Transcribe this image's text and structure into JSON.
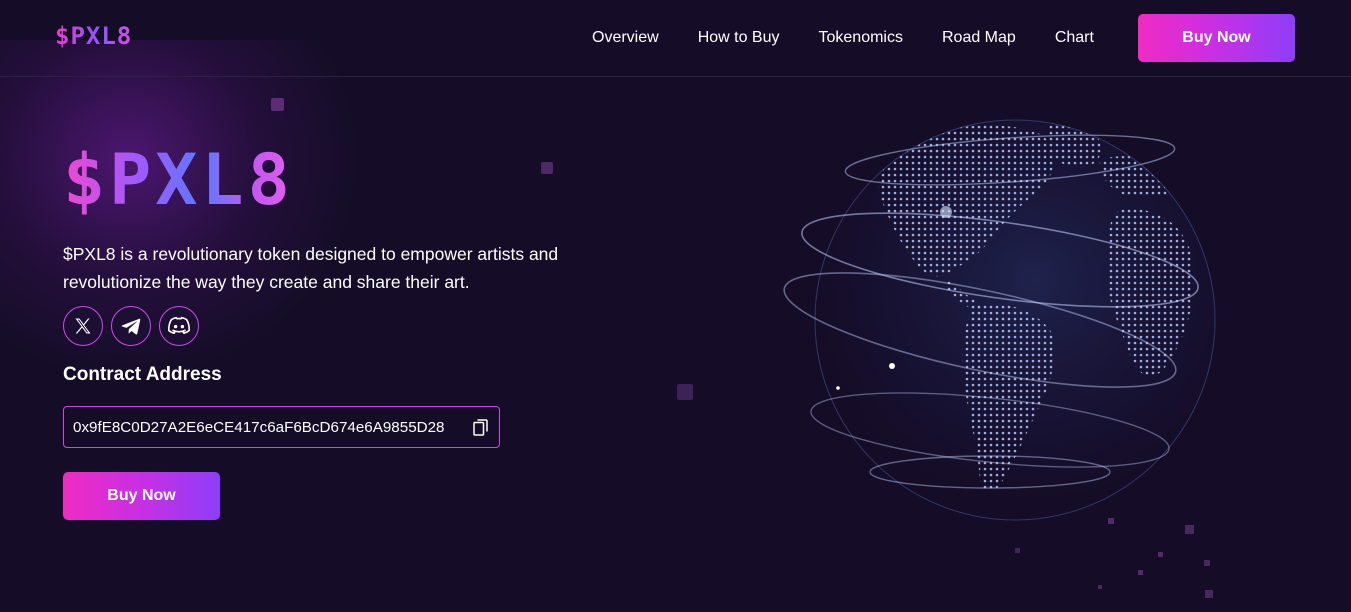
{
  "header": {
    "logo_text": "$PXL8",
    "nav": [
      {
        "label": "Overview"
      },
      {
        "label": "How to Buy"
      },
      {
        "label": "Tokenomics"
      },
      {
        "label": "Road Map"
      },
      {
        "label": "Chart"
      }
    ],
    "buy_label": "Buy Now"
  },
  "hero": {
    "logo_text": "$PXL8",
    "description": "$PXL8 is a revolutionary token designed to empower artists and revolutionize the way they create and share their art.",
    "socials": [
      {
        "icon": "x-icon"
      },
      {
        "icon": "telegram-icon"
      },
      {
        "icon": "discord-icon"
      }
    ],
    "contract_title": "Contract Address",
    "contract_address": "0x9fE8C0D27A2E6eCE417c6aF6BcD674e6A9855D28",
    "copy_icon": "copy-icon",
    "buy_label": "Buy Now"
  },
  "colors": {
    "background": "#150d27",
    "accent_pink": "#f02bc3",
    "accent_purple": "#8e3ef9",
    "border": "#c44de6"
  }
}
